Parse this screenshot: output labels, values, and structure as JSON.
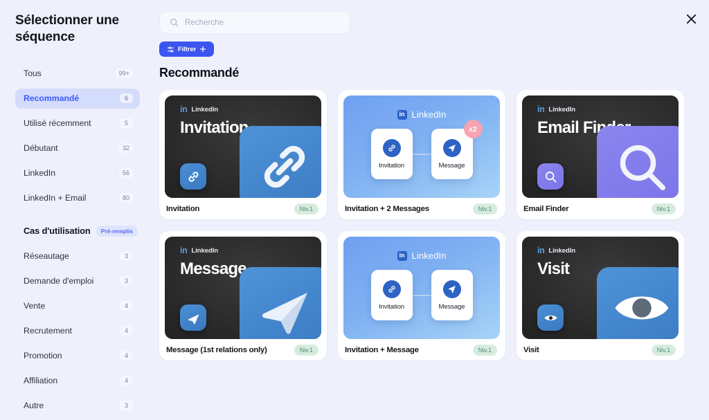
{
  "sidebar": {
    "title": "Sélectionner une séquence",
    "nav": [
      {
        "label": "Tous",
        "count": "99+",
        "active": false
      },
      {
        "label": "Recommandé",
        "count": "6",
        "active": true
      },
      {
        "label": "Utilisé récemment",
        "count": "5",
        "active": false
      },
      {
        "label": "Débutant",
        "count": "32",
        "active": false
      },
      {
        "label": "LinkedIn",
        "count": "56",
        "active": false
      },
      {
        "label": "LinkedIn + Email",
        "count": "80",
        "active": false
      }
    ],
    "usecase_section": {
      "title": "Cas d'utilisation",
      "badge": "Pré-remplis",
      "items": [
        {
          "label": "Réseautage",
          "count": "3"
        },
        {
          "label": "Demande d'emploi",
          "count": "3"
        },
        {
          "label": "Vente",
          "count": "4"
        },
        {
          "label": "Recrutement",
          "count": "4"
        },
        {
          "label": "Promotion",
          "count": "4"
        },
        {
          "label": "Affiliation",
          "count": "4"
        },
        {
          "label": "Autre",
          "count": "3"
        }
      ]
    }
  },
  "main": {
    "search": {
      "placeholder": "Recherche",
      "value": ""
    },
    "filter_button": {
      "label": "Filtrer"
    },
    "section_title": "Recommandé",
    "cards": [
      {
        "name": "Invitation",
        "level": "Niv.1",
        "art_style": "dark",
        "art_title": "Invitation",
        "brand": {
          "in": "in",
          "word": "LinkedIn"
        },
        "icon": "link-icon",
        "panel_color": "blue"
      },
      {
        "name": "Invitation + 2 Messages",
        "level": "Niv.1",
        "art_style": "blue",
        "brand": {
          "in": "in",
          "word": "LinkedIn"
        },
        "steps": [
          {
            "label": "Invitation",
            "icon": "link-icon"
          },
          {
            "label": "Message",
            "icon": "send-icon"
          }
        ],
        "repeat_badge": "x2"
      },
      {
        "name": "Email Finder",
        "level": "Niv.1",
        "art_style": "dark",
        "art_title": "Email Finder",
        "brand": {
          "in": "in",
          "word": "LinkedIn"
        },
        "icon": "magnifier-icon",
        "panel_color": "purple"
      },
      {
        "name": "Message (1st relations only)",
        "level": "Niv.1",
        "art_style": "dark",
        "art_title": "Message",
        "brand": {
          "in": "in",
          "word": "LinkedIn"
        },
        "icon": "send-icon",
        "panel_color": "blue"
      },
      {
        "name": "Invitation + Message",
        "level": "Niv.1",
        "art_style": "blue",
        "brand": {
          "in": "in",
          "word": "LinkedIn"
        },
        "steps": [
          {
            "label": "Invitation",
            "icon": "link-icon"
          },
          {
            "label": "Message",
            "icon": "send-icon"
          }
        ],
        "repeat_badge": ""
      },
      {
        "name": "Visit",
        "level": "Niv.1",
        "art_style": "dark",
        "art_title": "Visit",
        "brand": {
          "in": "in",
          "word": "LinkedIn"
        },
        "icon": "eye-icon",
        "panel_color": "blue"
      }
    ]
  },
  "close_button": {
    "label": "×"
  },
  "colors": {
    "accent": "#3b55f0",
    "active_nav_bg": "#d4dcfb",
    "level_badge_bg": "#d7ecdf",
    "level_badge_text": "#4e8d73",
    "repeat_badge_bg": "#f7a3b2",
    "page_bg": "#eef1fb"
  }
}
